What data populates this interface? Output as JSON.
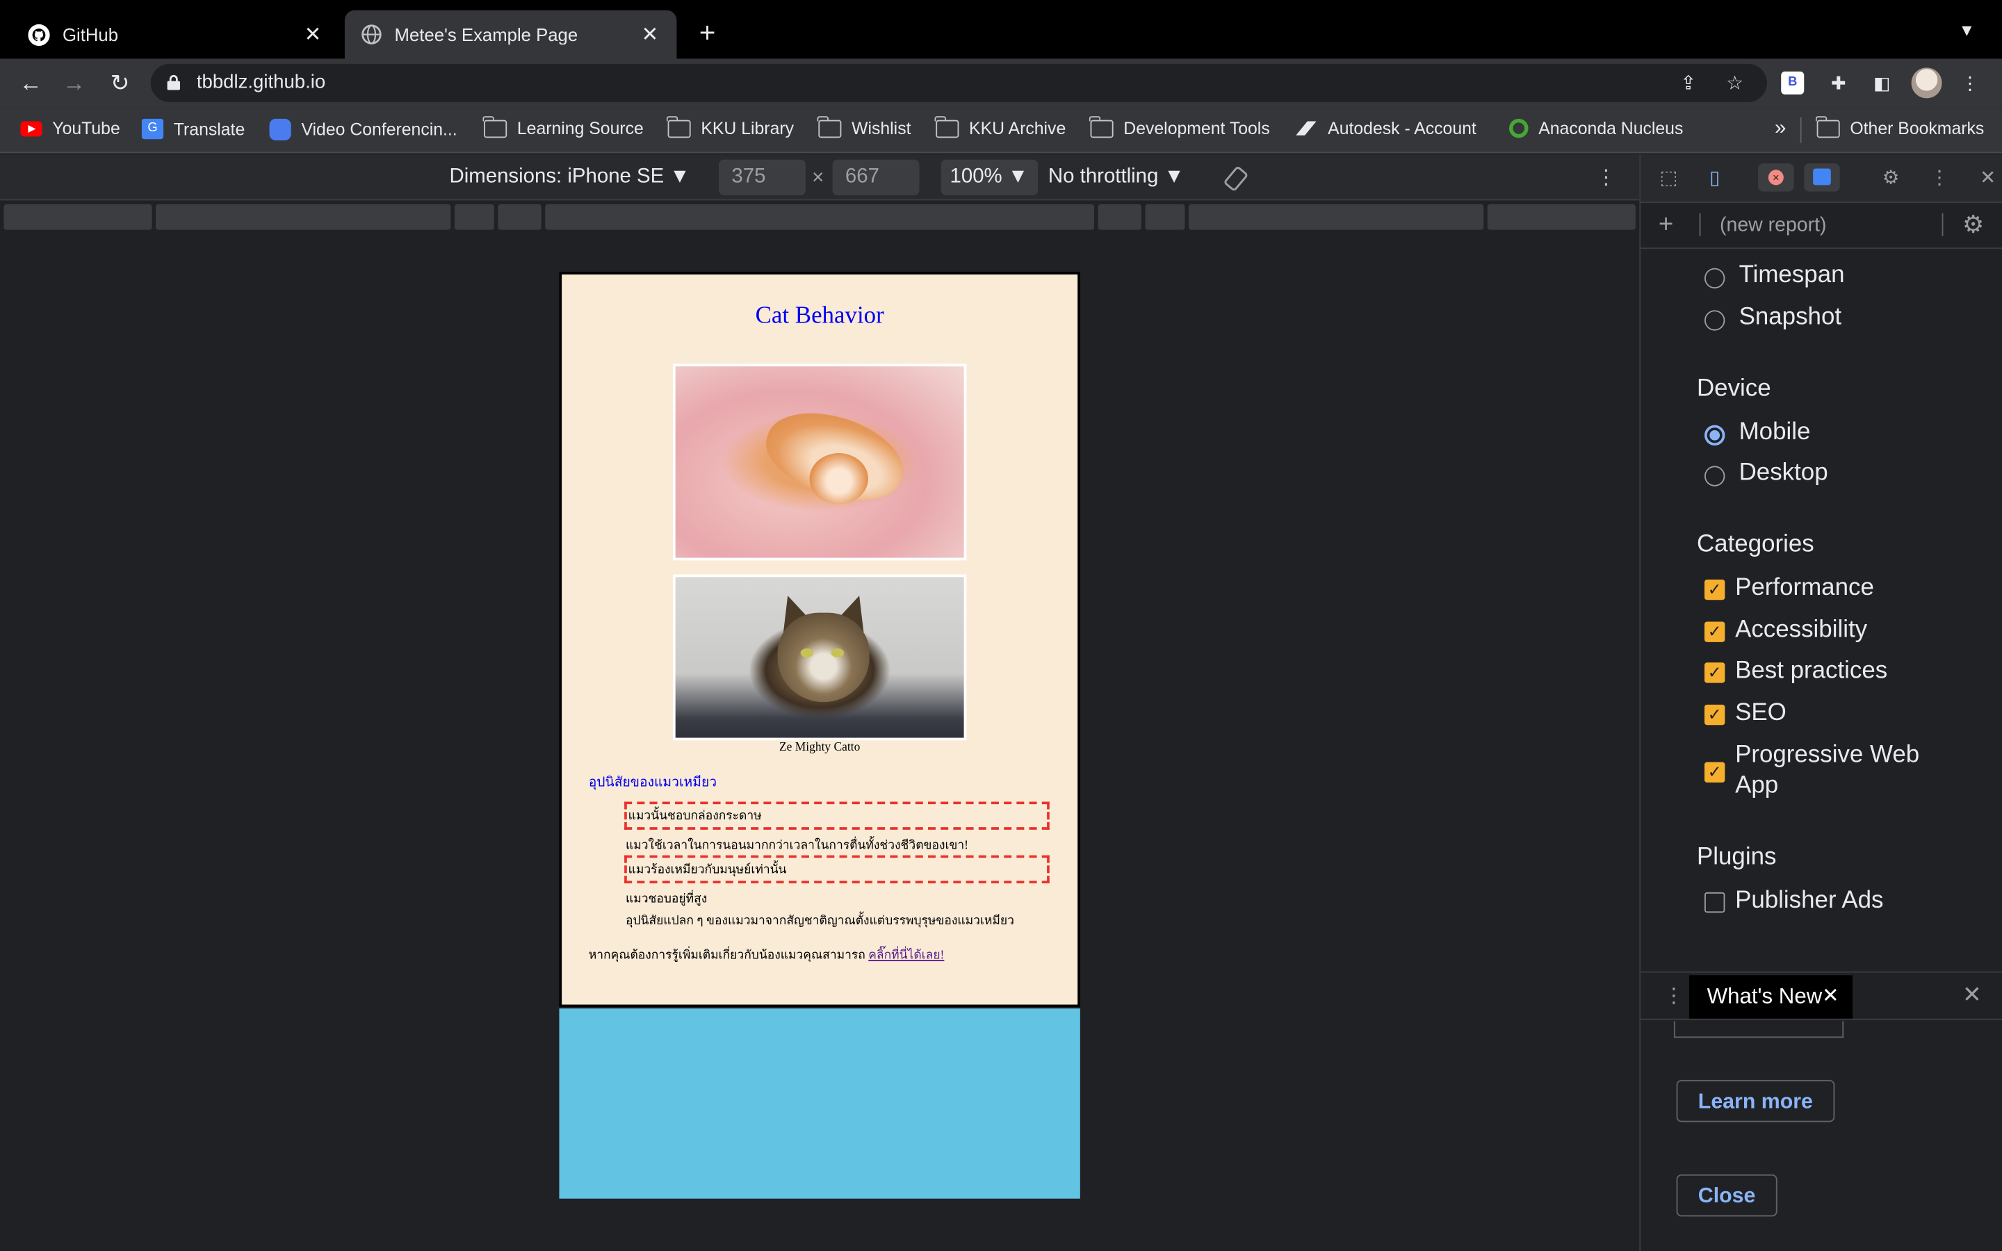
{
  "tabs": [
    {
      "title": "GitHub",
      "icon": "github-icon"
    },
    {
      "title": "Metee's Example Page",
      "icon": "globe-icon"
    }
  ],
  "omnibox": {
    "url": "tbbdlz.github.io"
  },
  "bookmarks": [
    {
      "label": "YouTube",
      "icon": "youtube-icon"
    },
    {
      "label": "Translate",
      "icon": "translate-icon"
    },
    {
      "label": "Video Conferencin...",
      "icon": "video-icon"
    },
    {
      "label": "Learning Source",
      "icon": "folder-icon"
    },
    {
      "label": "KKU Library",
      "icon": "folder-icon"
    },
    {
      "label": "Wishlist",
      "icon": "folder-icon"
    },
    {
      "label": "KKU Archive",
      "icon": "folder-icon"
    },
    {
      "label": "Development Tools",
      "icon": "folder-icon"
    },
    {
      "label": "Autodesk - Account",
      "icon": "autodesk-icon"
    },
    {
      "label": "Anaconda Nucleus",
      "icon": "anaconda-icon"
    }
  ],
  "other_bookmarks": "Other Bookmarks",
  "device_toolbar": {
    "dimensions": "Dimensions: iPhone SE",
    "width": "375",
    "height": "667",
    "zoom": "100%",
    "throttling": "No throttling"
  },
  "page": {
    "title": "Cat Behavior",
    "caption": "Ze Mighty Catto",
    "subheading": "อุปนิสัยของแมวเหมียว",
    "items": [
      "แมวนั้นชอบกล่องกระดาษ",
      "แมวใช้เวลาในการนอนมากกว่าเวลาในการตื่นทั้งช่วงชีวิตของเขา!",
      "แมวร้องเหมียวกับมนุษย์เท่านั้น",
      "แมวชอบอยู่ที่สูง",
      "อุปนิสัยแปลก ๆ ของแมวมาจากสัญชาติญาณตั้งแต่บรรพบุรุษของแมวเหมียว"
    ],
    "footer_text": "หากคุณต้องการรู้เพิ่มเติมเกี่ยวกับน้องแมวคุณสามารถ",
    "footer_link": "คลิ๊กที่นี่ได้เลย!"
  },
  "devtools": {
    "report_placeholder": "(new report)",
    "modes": [
      "Timespan",
      "Snapshot"
    ],
    "device_heading": "Device",
    "devices": [
      "Mobile",
      "Desktop"
    ],
    "selected_device": "Mobile",
    "categories_heading": "Categories",
    "categories": [
      "Performance",
      "Accessibility",
      "Best practices",
      "SEO",
      "Progressive Web",
      "App"
    ],
    "plugins_heading": "Plugins",
    "plugins": [
      "Publisher Ads"
    ],
    "drawer_tab": "What's New",
    "learn_more": "Learn more",
    "close": "Close"
  },
  "colors": {
    "page_background": "#faebd7",
    "title_color": "#0000ee",
    "dashed_border": "#e8332b",
    "blue_box": "#62c3e3",
    "checkbox": "#f6ae2d",
    "devtools_link": "#8ab4f8"
  }
}
